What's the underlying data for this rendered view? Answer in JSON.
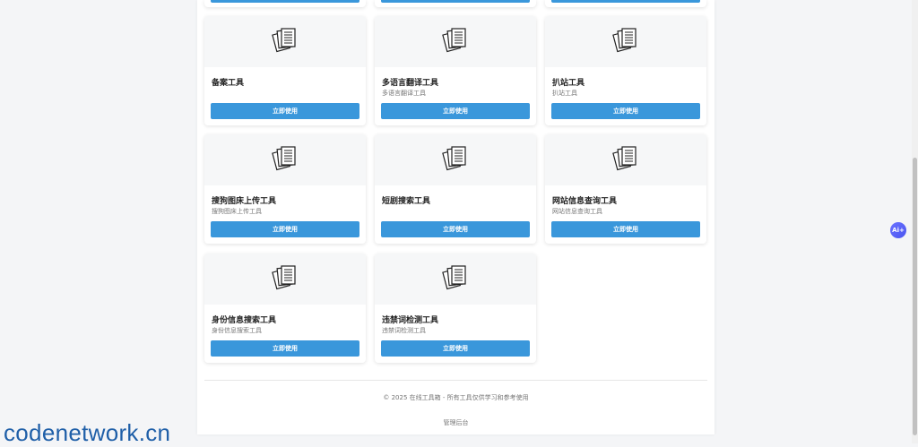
{
  "cards": [
    {
      "title": "备案工具",
      "desc": "",
      "button": "立即使用"
    },
    {
      "title": "多语言翻译工具",
      "desc": "多语言翻译工具",
      "button": "立即使用"
    },
    {
      "title": "扒站工具",
      "desc": "扒站工具",
      "button": "立即使用"
    },
    {
      "title": "搜狗图床上传工具",
      "desc": "搜狗图床上传工具",
      "button": "立即使用"
    },
    {
      "title": "短剧搜索工具",
      "desc": "",
      "button": "立即使用"
    },
    {
      "title": "网站信息查询工具",
      "desc": "网站信息查询工具",
      "button": "立即使用"
    },
    {
      "title": "身份信息搜索工具",
      "desc": "身份信息搜索工具",
      "button": "立即使用"
    },
    {
      "title": "违禁词检测工具",
      "desc": "违禁词检测工具",
      "button": "立即使用"
    }
  ],
  "footer": {
    "copyright": "© 2025 在线工具箱 - 所有工具仅供学习和参考使用",
    "admin": "管理后台"
  },
  "ai_badge": "Ai+",
  "watermark": "codenetwork.cn",
  "colors": {
    "accent": "#3a97db",
    "background": "#f4f5f7"
  },
  "icons": {
    "card_icon": "documents-icon"
  }
}
